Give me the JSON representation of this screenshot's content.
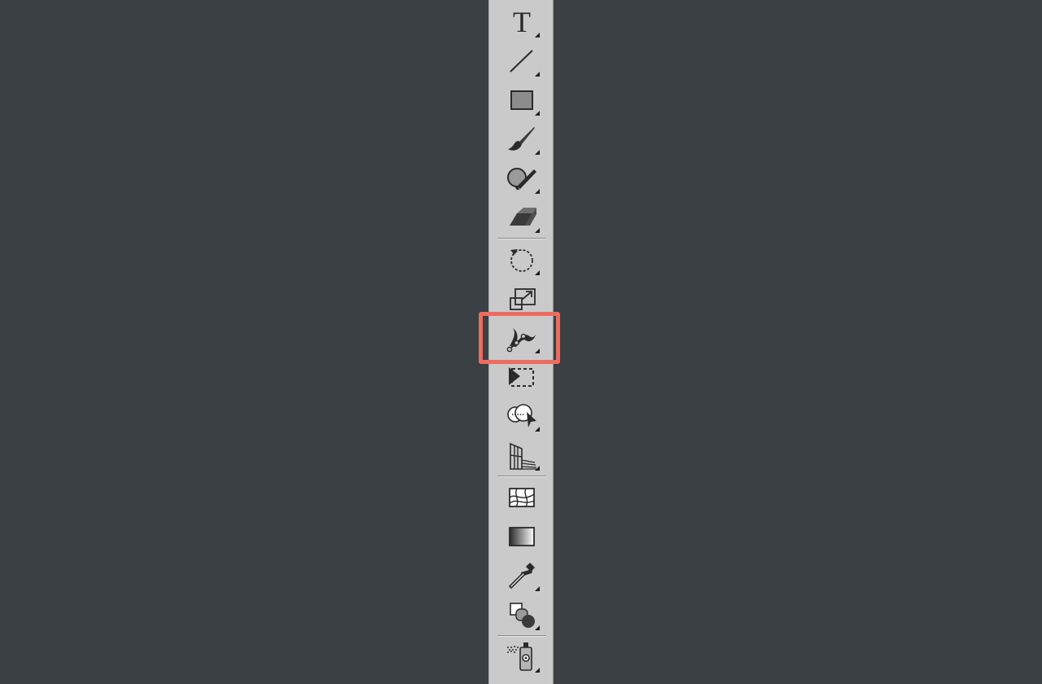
{
  "toolbar": {
    "accent_color": "#ee6b60",
    "selected_tool": "width",
    "groups": [
      {
        "tools": [
          {
            "id": "type",
            "icon": "type-icon",
            "has_flyout": true
          },
          {
            "id": "line-segment",
            "icon": "line-segment-icon",
            "has_flyout": true
          },
          {
            "id": "rectangle",
            "icon": "rectangle-icon",
            "has_flyout": true
          },
          {
            "id": "paintbrush",
            "icon": "paintbrush-icon",
            "has_flyout": true
          },
          {
            "id": "blob-brush",
            "icon": "blob-brush-icon",
            "has_flyout": true
          },
          {
            "id": "eraser",
            "icon": "eraser-icon",
            "has_flyout": true
          }
        ]
      },
      {
        "tools": [
          {
            "id": "rotate",
            "icon": "rotate-icon",
            "has_flyout": true
          },
          {
            "id": "scale",
            "icon": "scale-icon",
            "has_flyout": false
          },
          {
            "id": "width",
            "icon": "width-tool-icon",
            "has_flyout": true,
            "selected": true
          },
          {
            "id": "free-transform",
            "icon": "free-transform-icon",
            "has_flyout": false
          },
          {
            "id": "shape-builder",
            "icon": "shape-builder-icon",
            "has_flyout": true
          },
          {
            "id": "perspective-grid",
            "icon": "perspective-grid-icon",
            "has_flyout": true
          }
        ]
      },
      {
        "tools": [
          {
            "id": "mesh",
            "icon": "mesh-icon",
            "has_flyout": false
          },
          {
            "id": "gradient",
            "icon": "gradient-icon",
            "has_flyout": false
          },
          {
            "id": "eyedropper",
            "icon": "eyedropper-icon",
            "has_flyout": true
          },
          {
            "id": "blend",
            "icon": "blend-icon",
            "has_flyout": true
          }
        ]
      },
      {
        "tools": [
          {
            "id": "symbol-sprayer",
            "icon": "symbol-sprayer-icon",
            "has_flyout": true
          }
        ]
      }
    ]
  }
}
